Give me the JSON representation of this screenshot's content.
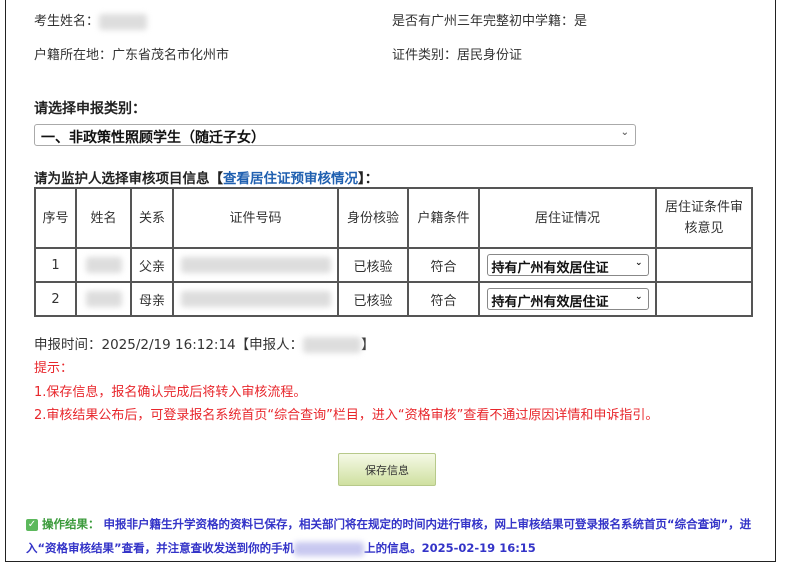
{
  "info": {
    "name_label": "考生姓名：",
    "middle_school_label": "是否有广州三年完整初中学籍：是",
    "hukou_label": "户籍所在地：广东省茂名市化州市",
    "id_type_label": "证件类别：居民身份证"
  },
  "category": {
    "label": "请选择申报类别：",
    "selected": "一、非政策性照顾学生（随迁子女）"
  },
  "guardian": {
    "label_prefix": "请为监护人选择审核项目信息【",
    "link": "查看居住证预审核情况",
    "label_suffix": "】："
  },
  "table": {
    "headers": [
      "序号",
      "姓名",
      "关系",
      "证件号码",
      "身份核验",
      "户籍条件",
      "居住证情况",
      "居住证条件审核意见"
    ],
    "rows": [
      {
        "no": "1",
        "relation": "父亲",
        "verify": "已核验",
        "hukou": "符合",
        "permit": "持有广州有效居住证"
      },
      {
        "no": "2",
        "relation": "母亲",
        "verify": "已核验",
        "hukou": "符合",
        "permit": "持有广州有效居住证"
      }
    ]
  },
  "submit": {
    "time_text": "申报时间：2025/2/19 16:12:14【申报人：",
    "close": "】"
  },
  "tips": {
    "title": "提示：",
    "items": [
      "1.保存信息，报名确认完成后将转入审核流程。",
      "2.审核结果公布后，可登录报名系统首页“综合查询”栏目，进入“资格审核”查看不通过原因详情和申诉指引。"
    ]
  },
  "save_button": "保存信息",
  "result": {
    "label": "操作结果：",
    "text1": "申报非户籍生升学资格的资料已保存，相关部门将在规定的时间内进行审核，网上审核结果可登录报名系统首页“综合查询”，进入“资格审核结果”查看，并注意查收发送到你的手机",
    "text2": "上的信息。2025-02-19 16:15"
  },
  "colors": {
    "tip_red": "#e8272c",
    "result_blue": "#3434c8",
    "link_blue": "#2060b0"
  }
}
